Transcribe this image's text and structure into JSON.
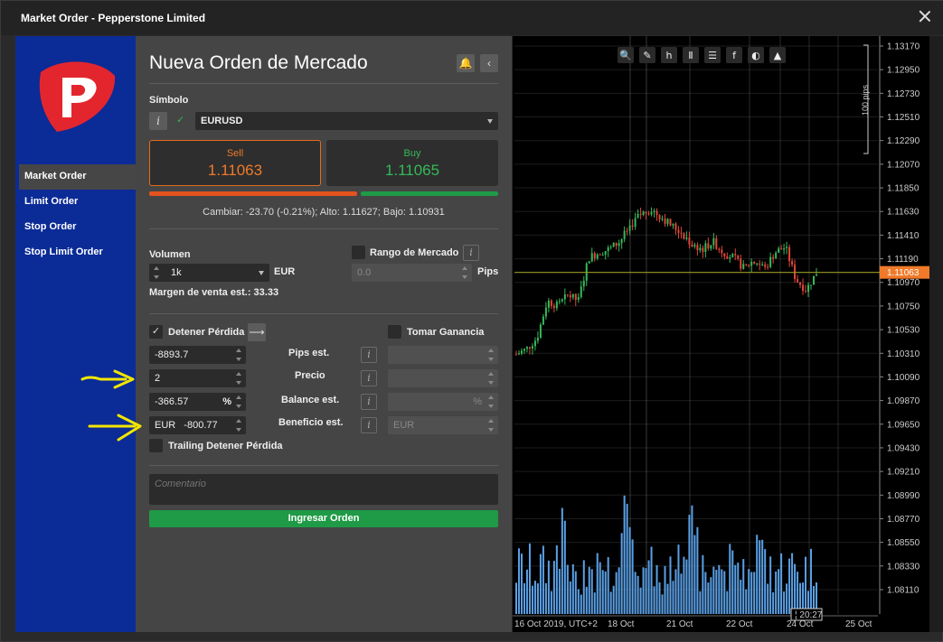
{
  "window": {
    "title": "Market Order - Pepperstone Limited"
  },
  "sidebar": {
    "items": [
      {
        "label": "Market Order",
        "active": true
      },
      {
        "label": "Limit Order",
        "active": false
      },
      {
        "label": "Stop Order",
        "active": false
      },
      {
        "label": "Stop Limit Order",
        "active": false
      }
    ]
  },
  "form": {
    "heading": "Nueva Orden de Mercado",
    "symbol_label": "Símbolo",
    "symbol_value": "EURUSD",
    "sell": {
      "label": "Sell",
      "price": "1.11063",
      "color": "#f07a2a"
    },
    "buy": {
      "label": "Buy",
      "price": "1.11065",
      "color": "#35b95a"
    },
    "sentiment_sell_fraction": 0.6,
    "stats": "Cambiar: -23.70 (-0.21%); Alto: 1.11627; Bajo: 1.10931",
    "volume": {
      "label": "Volumen",
      "value": "1k",
      "unit": "EUR",
      "margin": "Margen de venta est.: 33.33"
    },
    "market_range": {
      "label": "Rango de Mercado",
      "value": "0.0",
      "unit": "Pips"
    },
    "stop_loss": {
      "label": "Detener Pérdida",
      "checked": true,
      "pips": "-8893.7",
      "price": "2",
      "balance": "-366.57",
      "balance_unit": "%",
      "profit_currency": "EUR",
      "profit": "-800.77"
    },
    "row_labels": {
      "pips": "Pips est.",
      "price": "Precio",
      "balance": "Balance est.",
      "profit": "Beneficio est."
    },
    "take_profit": {
      "label": "Tomar Ganancia",
      "checked": false,
      "balance_unit": "%",
      "profit_currency": "EUR"
    },
    "trailing": {
      "label": "Trailing Detener Pérdida",
      "checked": false
    },
    "comment_placeholder": "Comentario",
    "submit_label": "Ingresar Orden"
  },
  "chart_data": {
    "type": "candlestick",
    "symbol": "EURUSD",
    "current_price": "1.11063",
    "pips_marker": "100 pips",
    "y_ticks": [
      "1.13170",
      "1.12950",
      "1.12730",
      "1.12510",
      "1.12290",
      "1.12070",
      "1.11850",
      "1.11630",
      "1.11410",
      "1.11190",
      "1.10970",
      "1.10750",
      "1.10530",
      "1.10310",
      "1.10090",
      "1.09870",
      "1.09650",
      "1.09430",
      "1.09210",
      "1.08990",
      "1.08770",
      "1.08550",
      "1.08330",
      "1.08110"
    ],
    "x_ticks": [
      "16 Oct 2019, UTC+2",
      "18 Oct",
      "21 Oct",
      "22 Oct",
      "24 Oct",
      "25 Oct"
    ],
    "crosshair_time": "20:27",
    "ylim": [
      1.0795,
      1.1325
    ],
    "approx_close_path": [
      1.103,
      1.1035,
      1.1045,
      1.108,
      1.1075,
      1.1085,
      1.108,
      1.112,
      1.1125,
      1.1128,
      1.1135,
      1.115,
      1.116,
      1.1165,
      1.1158,
      1.115,
      1.1143,
      1.1132,
      1.1128,
      1.1135,
      1.1125,
      1.112,
      1.111,
      1.1118,
      1.111,
      1.1125,
      1.113,
      1.11,
      1.109,
      1.1106
    ],
    "toolbar_icons": [
      "zoom-icon",
      "draw-icon",
      "timeframe-icon",
      "candles-icon",
      "list-icon",
      "facebook-icon",
      "drop-icon",
      "shapes-icon"
    ],
    "colors": {
      "up": "#35b95a",
      "down": "#e0473a",
      "volume": "#5aa0e6",
      "price_line": "#9a9a2a",
      "price_label_bg": "#f07a2a"
    }
  }
}
